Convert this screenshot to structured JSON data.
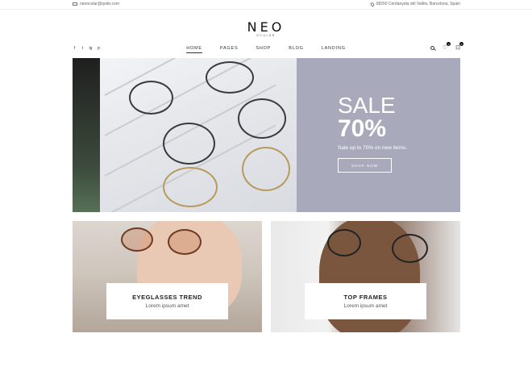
{
  "topbar": {
    "email": "neoocular@qode.com",
    "address": "08290 Cerdanyola del Vallès, Barcelona, Spain"
  },
  "logo": {
    "word": "NEO",
    "sub": "OCULAR"
  },
  "social": [
    "f",
    "t",
    "ig",
    "p"
  ],
  "nav": {
    "items": [
      "HOME",
      "PAGES",
      "SHOP",
      "BLOG",
      "LANDING"
    ],
    "active": "HOME",
    "wishlist_count": "0",
    "cart_count": "0"
  },
  "hero": {
    "title": "SALE",
    "percent": "70%",
    "subtitle": "Sale up to 70% on new items.",
    "button": "SHOP NOW",
    "accent": "#a8aabc"
  },
  "cards": [
    {
      "title": "EYEGLASSES TREND",
      "subtitle": "Lorem ipsum amet"
    },
    {
      "title": "TOP FRAMES",
      "subtitle": "Lorem ipsum amet"
    }
  ]
}
